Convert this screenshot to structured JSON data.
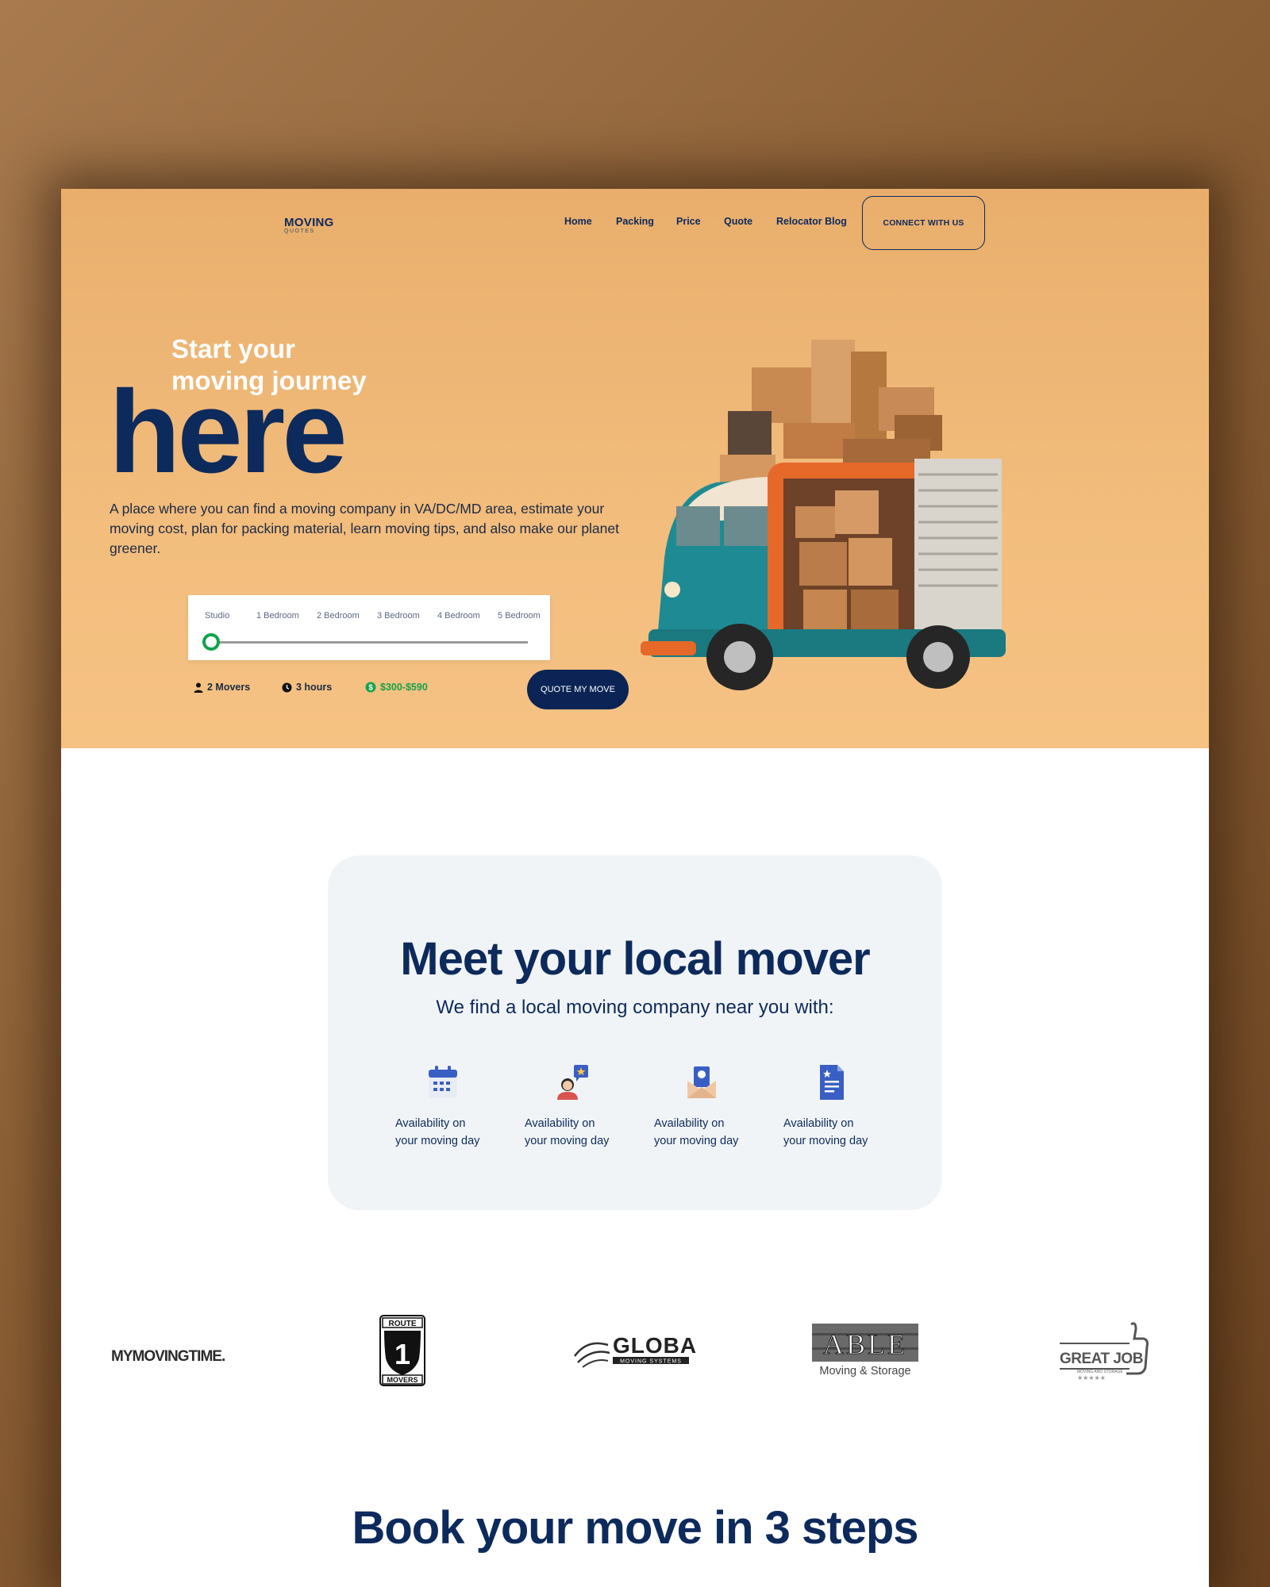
{
  "header": {
    "logo": {
      "main": "MOVING",
      "sub": "QUOTES"
    },
    "nav": [
      "Home",
      "Packing",
      "Price",
      "Quote",
      "Relocator Blog"
    ],
    "cta": "CONNECT WITH US"
  },
  "hero": {
    "tagline_line1": "Start your",
    "tagline_line2": "moving journey",
    "headline": "here",
    "description": "A place where you can find a moving company in VA/DC/MD area, estimate your moving cost, plan for packing material, learn moving tips, and also make our planet greener.",
    "slider": {
      "options": [
        "Studio",
        "1 Bedroom",
        "2 Bedroom",
        "3 Bedroom",
        "4 Bedroom",
        "5 Bedroom"
      ],
      "selected": "Studio",
      "selected_fraction": 0.0
    },
    "stats": {
      "movers": "2 Movers",
      "hours": "3 hours",
      "price": "$300-$590"
    },
    "quote_button": "QUOTE MY MOVE"
  },
  "mover_section": {
    "title": "Meet your local mover",
    "subtitle": "We find a local moving company near you with:",
    "features": [
      {
        "icon": "calendar-icon",
        "line1": "Availability on",
        "line2": "your moving day"
      },
      {
        "icon": "mover-person-icon",
        "line1": "Availability on",
        "line2": "your moving day"
      },
      {
        "icon": "envelope-money-icon",
        "line1": "Availability on",
        "line2": "your moving day"
      },
      {
        "icon": "document-icon",
        "line1": "Availability on",
        "line2": "your moving day"
      }
    ]
  },
  "brands": [
    {
      "name": "MYMOVINGTIME."
    },
    {
      "name": "ROUTE 1 MOVERS",
      "top": "ROUTE",
      "num": "1",
      "bottom": "MOVERS"
    },
    {
      "name": "GLOBAL",
      "sub": "MOVING SYSTEMS"
    },
    {
      "name": "ABLE",
      "sub": "Moving & Storage"
    },
    {
      "name": "GREAT JOB",
      "sub": "MOVING AND STORAGE"
    }
  ],
  "steps_section": {
    "title": "Book your move in 3 steps"
  },
  "colors": {
    "navy": "#0d2a5c",
    "hero_bg": "#f2bd7d",
    "accent_green": "#14a34b",
    "button_dark": "#0b2455"
  }
}
